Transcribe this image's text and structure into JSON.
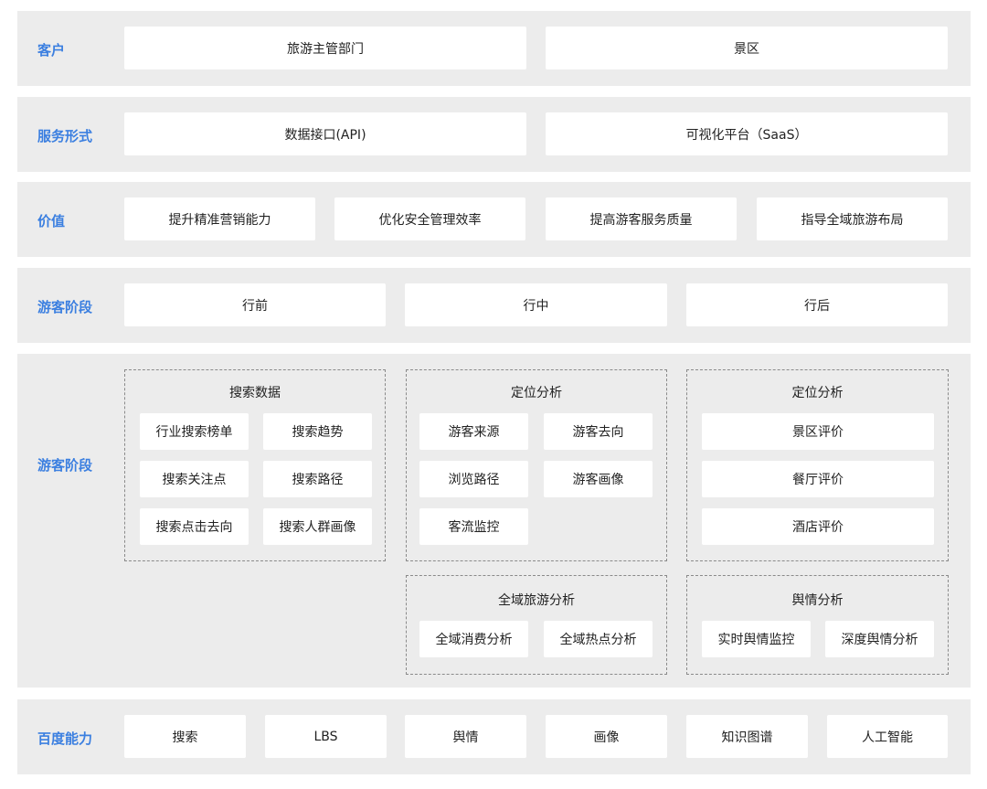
{
  "rows": {
    "customer": {
      "label": "客户",
      "items": [
        "旅游主管部门",
        "景区"
      ]
    },
    "service": {
      "label": "服务形式",
      "items": [
        "数据接口(API)",
        "可视化平台（SaaS）"
      ]
    },
    "value": {
      "label": "价值",
      "items": [
        "提升精准营销能力",
        "优化安全管理效率",
        "提高游客服务质量",
        "指导全域旅游布局"
      ]
    },
    "stage": {
      "label": "游客阶段",
      "items": [
        "行前",
        "行中",
        "行后"
      ]
    },
    "analysis": {
      "label": "游客阶段",
      "groups": {
        "search": {
          "title": "搜索数据",
          "items": [
            "行业搜索榜单",
            "搜索趋势",
            "搜索关注点",
            "搜索路径",
            "搜索点击去向",
            "搜索人群画像"
          ]
        },
        "location1": {
          "title": "定位分析",
          "items": [
            "游客来源",
            "游客去向",
            "浏览路径",
            "游客画像",
            "客流监控"
          ]
        },
        "location2": {
          "title": "定位分析",
          "items": [
            "景区评价",
            "餐厅评价",
            "酒店评价"
          ]
        },
        "global": {
          "title": "全域旅游分析",
          "items": [
            "全域消费分析",
            "全域热点分析"
          ]
        },
        "opinion": {
          "title": "舆情分析",
          "items": [
            "实时舆情监控",
            "深度舆情分析"
          ]
        }
      }
    },
    "baidu": {
      "label": "百度能力",
      "items": [
        "搜索",
        "LBS",
        "舆情",
        "画像",
        "知识图谱",
        "人工智能"
      ]
    }
  }
}
